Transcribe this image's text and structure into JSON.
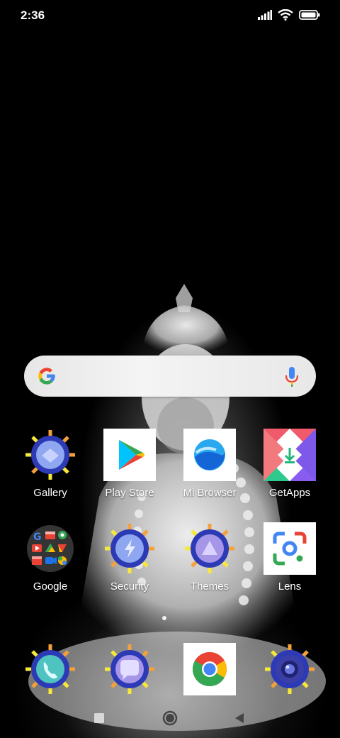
{
  "status_bar": {
    "time": "2:36",
    "icons": [
      "signal-icon",
      "wifi-icon",
      "battery-icon"
    ]
  },
  "search": {
    "icons": [
      "google-g-icon",
      "mic-icon"
    ]
  },
  "apps": [
    {
      "label": "Gallery",
      "icon": "gallery-icon"
    },
    {
      "label": "Play Store",
      "icon": "play-store-icon"
    },
    {
      "label": "Mi Browser",
      "icon": "mi-browser-icon"
    },
    {
      "label": "GetApps",
      "icon": "getapps-icon"
    },
    {
      "label": "Google",
      "icon": "google-folder-icon"
    },
    {
      "label": "Security",
      "icon": "security-icon"
    },
    {
      "label": "Themes",
      "icon": "themes-icon"
    },
    {
      "label": "Lens",
      "icon": "lens-icon"
    }
  ],
  "dock": [
    {
      "icon": "phone-icon"
    },
    {
      "icon": "messages-icon"
    },
    {
      "icon": "chrome-icon"
    },
    {
      "icon": "camera-icon"
    }
  ],
  "nav": {
    "buttons": [
      "recents-button",
      "home-button",
      "back-button"
    ]
  },
  "colors": {
    "google_blue": "#4285F4",
    "google_red": "#EA4335",
    "google_yellow": "#FBBC05",
    "google_green": "#34A853"
  }
}
